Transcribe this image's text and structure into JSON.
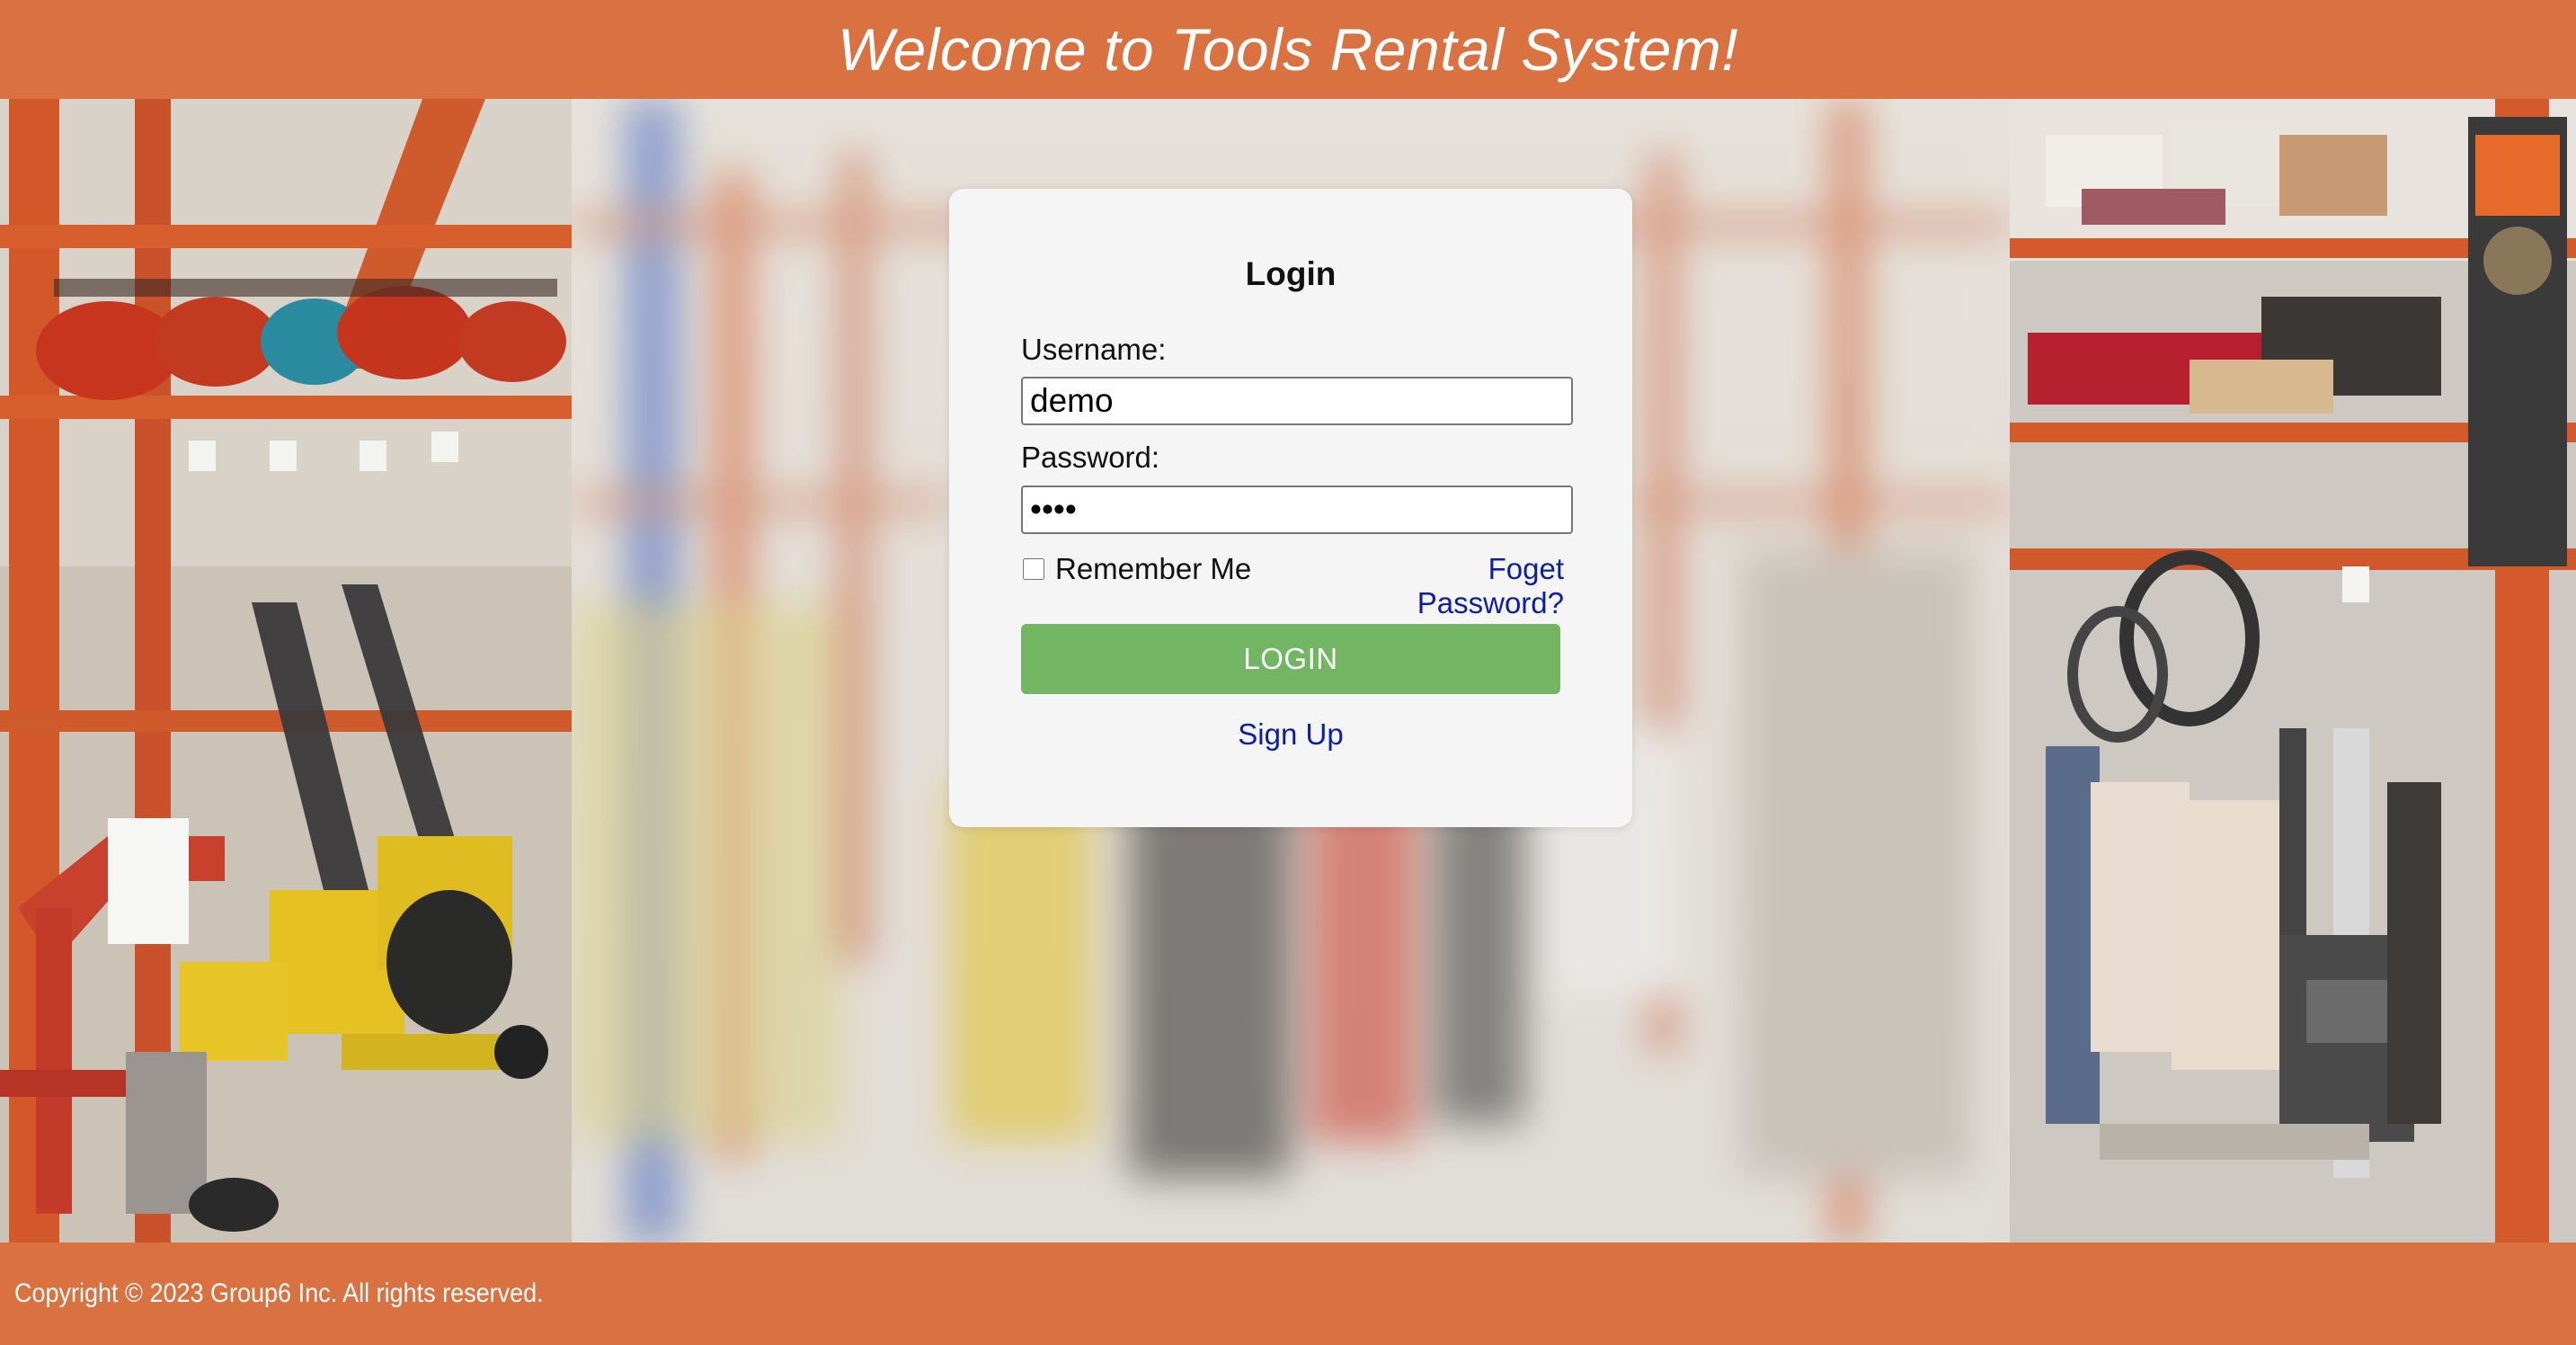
{
  "header": {
    "title": "Welcome to Tools Rental System!"
  },
  "login": {
    "heading": "Login",
    "username_label": "Username:",
    "username_value": "demo",
    "password_label": "Password:",
    "password_value": "demo",
    "remember_label": "Remember Me",
    "remember_checked": false,
    "forgot_label": "Foget Password?",
    "login_button": "LOGIN",
    "signup_label": "Sign Up"
  },
  "footer": {
    "copyright": "Copyright © 2023 Group6 Inc. All rights reserved."
  },
  "colors": {
    "header_bg": "#d97140",
    "footer_bg": "#d97140",
    "button_bg": "#72b562",
    "link": "#0a1ea6",
    "card_bg": "#f5f5f5"
  },
  "background": {
    "left_image": "tool-rental-shelves-photo",
    "center_image": "blurred-store-aisle-photo",
    "right_image": "tool-rental-equipment-photo"
  }
}
